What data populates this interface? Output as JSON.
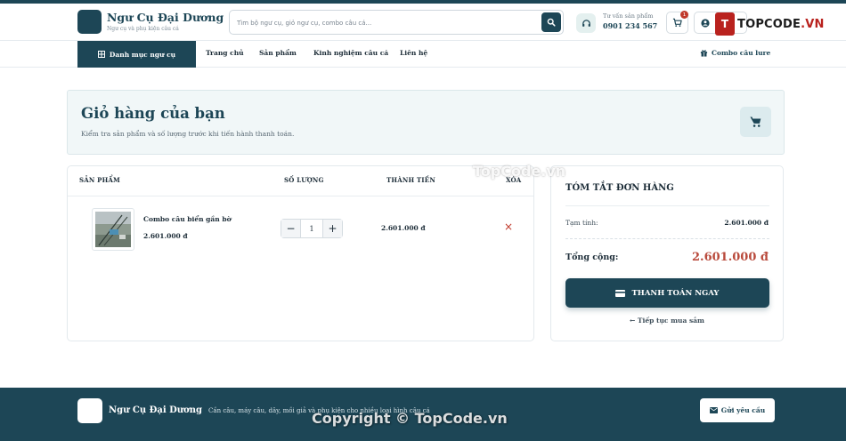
{
  "brand": {
    "name": "Ngư Cụ Đại Dương",
    "tagline": "Ngư cụ và phụ kiện câu cá"
  },
  "search": {
    "placeholder": "Tìm bộ ngư cụ, giỏ ngư cụ, combo câu cá..."
  },
  "hotline": {
    "label": "Tư vấn sản phẩm",
    "phone": "0901 234 567"
  },
  "cart_badge": "1",
  "account_label": "",
  "watermark": {
    "logo_letter": "T",
    "logo_text_main": "TOPCODE",
    "logo_text_suffix": ".VN",
    "overlay_mid": "TopCode.vn",
    "overlay_bottom": "Copyright © TopCode.vn"
  },
  "nav": {
    "category_label": "Danh mục ngư cụ",
    "links": [
      "Trang chủ",
      "Sản phẩm",
      "Kinh nghiệm câu cá",
      "Liên hệ"
    ],
    "combo_label": "Combo câu lure"
  },
  "page": {
    "title": "Giỏ hàng của bạn",
    "subtitle": "Kiểm tra sản phẩm và số lượng trước khi tiến hành thanh toán."
  },
  "cart": {
    "headers": {
      "product": "SẢN PHẨM",
      "quantity": "SỐ LƯỢNG",
      "total": "THÀNH TIỀN",
      "remove": "XÓA"
    },
    "items": [
      {
        "name": "Combo câu biển gần bờ",
        "price": "2.601.000 đ",
        "quantity": "1",
        "line_total": "2.601.000 đ",
        "minus": "−",
        "plus": "+",
        "remove_symbol": "×"
      }
    ]
  },
  "summary": {
    "title": "TÓM TẮT ĐƠN HÀNG",
    "subtotal_label": "Tạm tính:",
    "subtotal_value": "2.601.000 đ",
    "total_label": "Tổng cộng:",
    "total_value": "2.601.000 đ",
    "checkout_label": "THANH TOÁN NGAY",
    "continue_label": "← Tiếp tục mua sắm"
  },
  "footer": {
    "brand": "Ngư Cụ Đại Dương",
    "description": "Cần câu, máy câu, dây, mồi giả và phụ kiện cho nhiều loại hình câu cá",
    "button_label": "Gửi yêu cầu"
  },
  "colors": {
    "primary": "#1d4656",
    "accent_red": "#b94a3c",
    "panel_bg": "#f1f7f8"
  }
}
